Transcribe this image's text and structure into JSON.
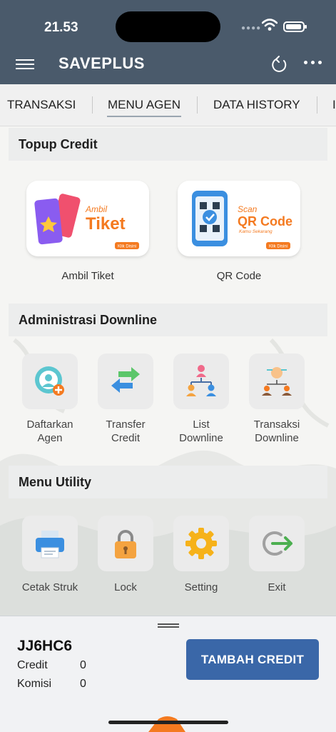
{
  "status": {
    "time": "21.53"
  },
  "appbar": {
    "title": "SAVEPLUS"
  },
  "tabs": [
    {
      "label": "TRANSAKSI"
    },
    {
      "label": "MENU AGEN"
    },
    {
      "label": "DATA HISTORY"
    },
    {
      "label": "I"
    }
  ],
  "topup": {
    "header": "Topup Credit",
    "cards": [
      {
        "label": "Ambil Tiket",
        "line1": "Ambil",
        "line2": "Tiket",
        "tag": "Klik Disini"
      },
      {
        "label": "QR Code",
        "line1": "Scan",
        "line2": "QR Code",
        "line3": "Kamu Sekarang",
        "tag": "Klik Disini"
      }
    ]
  },
  "admin": {
    "header": "Administrasi Downline",
    "items": [
      {
        "label1": "Daftarkan",
        "label2": "Agen"
      },
      {
        "label1": "Transfer",
        "label2": "Credit"
      },
      {
        "label1": "List",
        "label2": "Downline"
      },
      {
        "label1": "Transaksi",
        "label2": "Downline"
      }
    ]
  },
  "utility": {
    "header": "Menu Utility",
    "items": [
      {
        "label": "Cetak Struk"
      },
      {
        "label": "Lock"
      },
      {
        "label": "Setting"
      },
      {
        "label": "Exit"
      }
    ]
  },
  "account": {
    "code": "JJ6HC6",
    "credit_label": "Credit",
    "credit_value": "0",
    "komisi_label": "Komisi",
    "komisi_value": "0",
    "button_label": "TAMBAH CREDIT"
  },
  "colors": {
    "primary": "#4a5a6b",
    "button": "#3a67a8",
    "accent_orange": "#f47a20"
  }
}
